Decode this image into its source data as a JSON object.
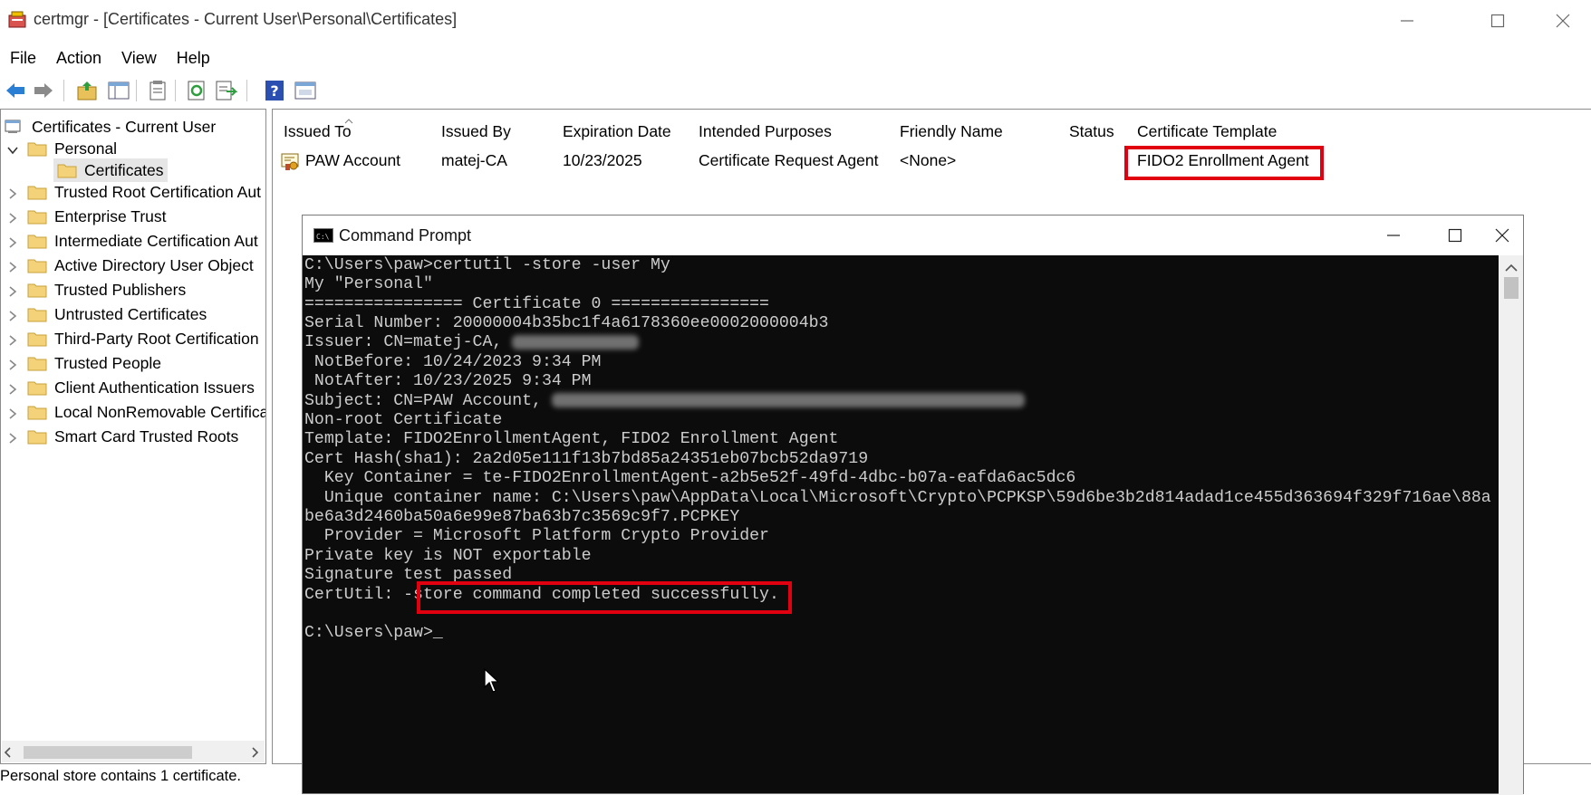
{
  "window": {
    "title": "certmgr - [Certificates - Current User\\Personal\\Certificates]",
    "controls": [
      "minimize",
      "maximize",
      "close"
    ]
  },
  "menu": [
    "File",
    "Action",
    "View",
    "Help"
  ],
  "toolbar_icons": [
    "back-icon",
    "forward-icon",
    "up-folder-icon",
    "show-hide-tree-icon",
    "copy-icon",
    "refresh-icon",
    "export-list-icon",
    "help-icon",
    "properties-icon"
  ],
  "tree": {
    "root": "Certificates - Current User",
    "personal": "Personal",
    "certificates": "Certificates",
    "items": [
      "Trusted Root Certification Aut",
      "Enterprise Trust",
      "Intermediate Certification Aut",
      "Active Directory User Object",
      "Trusted Publishers",
      "Untrusted Certificates",
      "Third-Party Root Certification",
      "Trusted People",
      "Client Authentication Issuers",
      "Local NonRemovable Certifica",
      "Smart Card Trusted Roots"
    ]
  },
  "table": {
    "columns": [
      "Issued To",
      "Issued By",
      "Expiration Date",
      "Intended Purposes",
      "Friendly Name",
      "Status",
      "Certificate Template"
    ],
    "rows": [
      {
        "issued_to": "PAW Account",
        "issued_by": "matej-CA",
        "expiration": "10/23/2025",
        "purposes": "Certificate Request Agent",
        "friendly": "<None>",
        "status": "",
        "template": "FIDO2 Enrollment Agent"
      }
    ]
  },
  "status_bar": "Personal store contains 1 certificate.",
  "cmd": {
    "title": "Command Prompt",
    "lines": [
      "C:\\Users\\paw>certutil -store -user My",
      "My \"Personal\"",
      "================ Certificate 0 ================",
      "Serial Number: 20000004b35bc1f4a6178360ee0002000004b3",
      "Issuer: CN=matej-CA, ",
      " NotBefore: 10/24/2023 9:34 PM",
      " NotAfter: 10/23/2025 9:34 PM",
      "Subject: CN=PAW Account, ",
      "Non-root Certificate",
      "Template: FIDO2EnrollmentAgent, FIDO2 Enrollment Agent",
      "Cert Hash(sha1): 2a2d05e111f13b7bd85a24351eb07bcb52da9719",
      "  Key Container = te-FIDO2EnrollmentAgent-a2b5e52f-49fd-4dbc-b07a-eafda6ac5dc6",
      "  Unique container name: C:\\Users\\paw\\AppData\\Local\\Microsoft\\Crypto\\PCPKSP\\59d6be3b2d814adad1ce455d363694f329f716ae\\88a",
      "be6a3d2460ba50a6e99e87ba63b7c3569c9f7.PCPKEY",
      "  Provider = Microsoft Platform Crypto Provider",
      "Private key is NOT exportable",
      "Signature test passed",
      "CertUtil: -store command completed successfully.",
      "",
      "C:\\Users\\paw>_"
    ]
  },
  "colors": {
    "highlight": "#e0000f",
    "console_bg": "#0c0c0c",
    "console_fg": "#cccccc",
    "selection": "#e6e6e6"
  }
}
